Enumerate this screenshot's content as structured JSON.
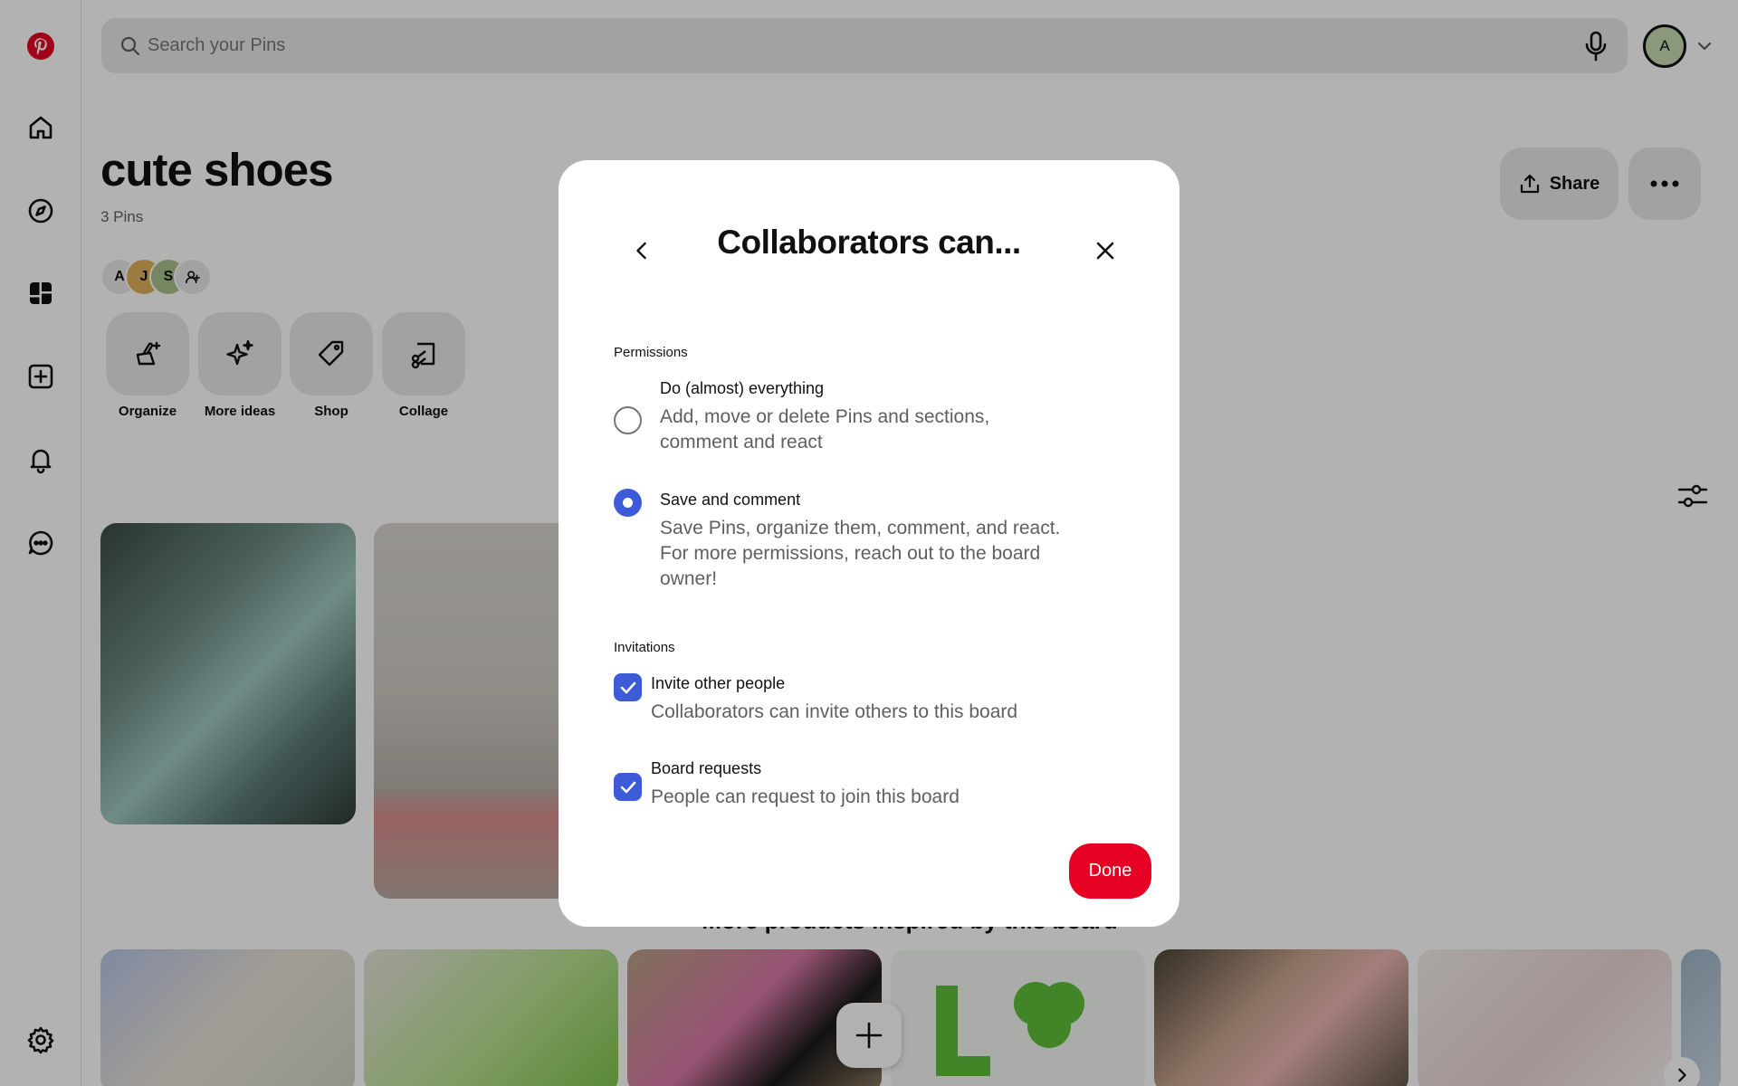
{
  "search": {
    "placeholder": "Search your Pins"
  },
  "user": {
    "initial": "A"
  },
  "board": {
    "title": "cute shoes",
    "pin_count": "3 Pins",
    "collaborators": [
      {
        "initial": "A",
        "color": "#e9e9e9"
      },
      {
        "initial": "J",
        "color": "#e0b25a"
      },
      {
        "initial": "S",
        "color": "#a9c08b"
      }
    ],
    "tools": [
      {
        "label": "Organize",
        "icon": "broom-icon"
      },
      {
        "label": "More ideas",
        "icon": "sparkle-icon"
      },
      {
        "label": "Shop",
        "icon": "tag-icon"
      },
      {
        "label": "Collage",
        "icon": "scissors-icon"
      }
    ],
    "share_label": "Share"
  },
  "products": {
    "title": "More products inspired by this board"
  },
  "sidebar": {
    "items": [
      "pinterest-logo-icon",
      "home-icon",
      "explore-icon",
      "boards-icon",
      "create-icon",
      "notifications-icon",
      "messages-icon",
      "settings-icon"
    ]
  },
  "modal": {
    "title": "Collaborators can...",
    "permissions_heading": "Permissions",
    "permissions": [
      {
        "title": "Do (almost) everything",
        "desc_line1": "Add, move or delete Pins and sections,",
        "desc_line2": "comment and react",
        "selected": false
      },
      {
        "title": "Save and comment",
        "desc_line1": "Save Pins, organize them, comment, and react.",
        "desc_line2": "For more permissions, reach out to the board",
        "desc_line3": "owner!",
        "selected": true
      }
    ],
    "invitations_heading": "Invitations",
    "invitations": [
      {
        "title": "Invite other people",
        "desc": "Collaborators can invite others to this board",
        "checked": true
      },
      {
        "title": "Board requests",
        "desc": "People can request to join this board",
        "checked": true
      }
    ],
    "done_label": "Done"
  },
  "colors": {
    "brand_red": "#e60023",
    "accent_blue": "#3d5bd9"
  }
}
